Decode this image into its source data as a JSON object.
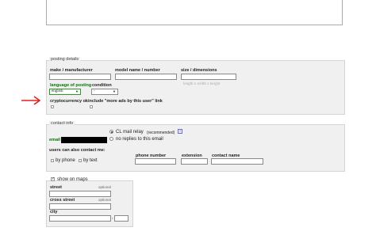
{
  "posting_details": {
    "legend": "posting details",
    "make_label": "make / manufacturer",
    "model_label": "model name / number",
    "size_label": "size / dimensions",
    "size_placeholder": "length x width x height",
    "language_label": "language of posting",
    "language_value": "english",
    "condition_label": "condition",
    "condition_value": "-",
    "crypto_label": "cryptocurrency ok",
    "more_ads_label": "include \"more ads by this user\" link"
  },
  "contact_info": {
    "legend": "contact info",
    "email_label": "email",
    "relay_label": "CL mail relay",
    "relay_note": "(recommended)",
    "no_replies_label": "no replies to this email",
    "help_glyph": "?",
    "also_label": "users can also contact me:",
    "by_phone_label": "by phone",
    "by_text_label": "by text",
    "phone_label": "phone number",
    "extension_label": "extension",
    "contact_name_label": "contact name"
  },
  "maps": {
    "show_label": "show on maps",
    "street_label": "street",
    "cross_street_label": "cross street",
    "city_label": "city",
    "optional_text": "optional"
  },
  "colors": {
    "arrow": "#e0201c",
    "panel": "#f0f0f0",
    "email_green": "#007a00",
    "language_green": "#007a00"
  }
}
